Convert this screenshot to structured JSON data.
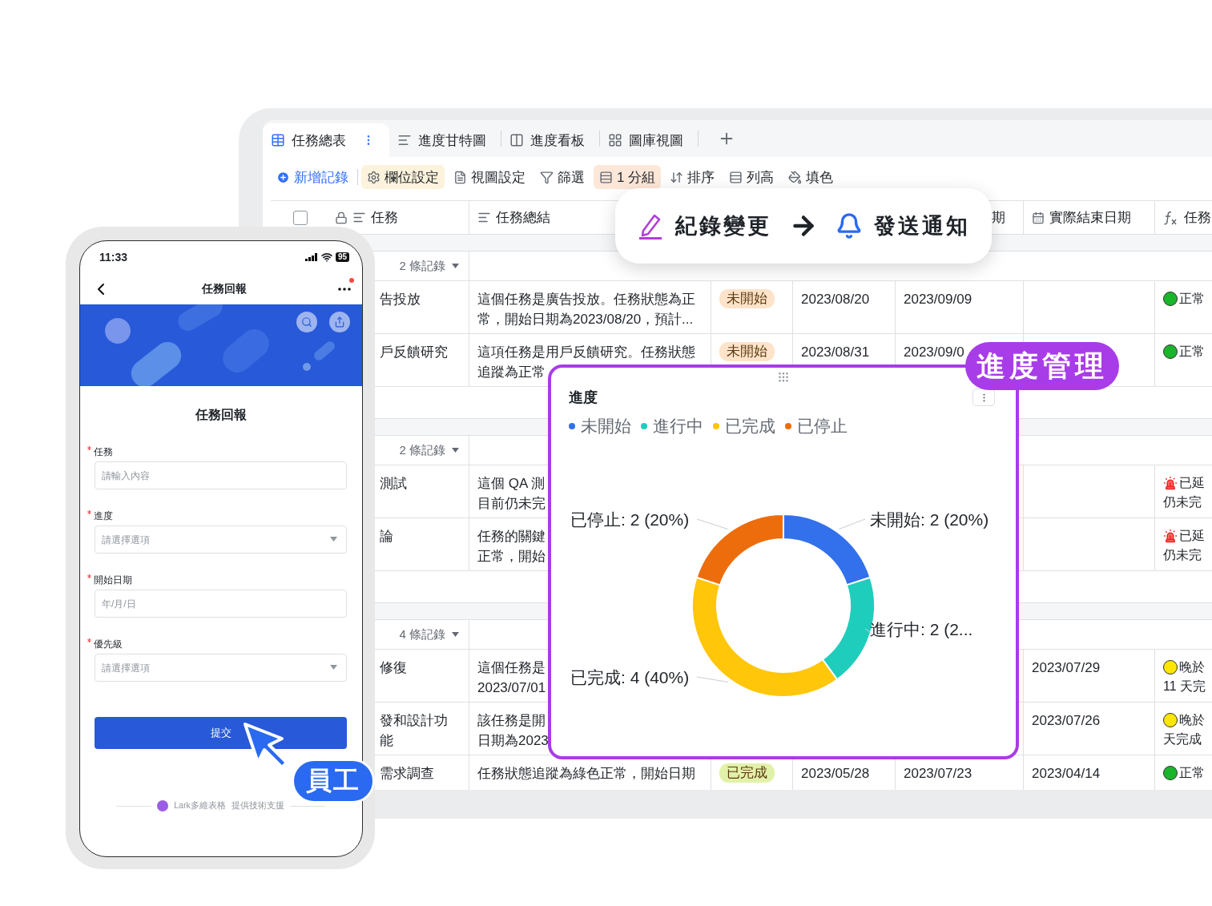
{
  "window": {
    "tabs": [
      {
        "label": "任務總表",
        "selected": true
      },
      {
        "label": "進度甘特圖",
        "selected": false
      },
      {
        "label": "進度看板",
        "selected": false
      },
      {
        "label": "圖庫視圖",
        "selected": false
      }
    ],
    "toolbar": [
      {
        "label": "新增記錄",
        "kind": "primary"
      },
      {
        "label": "欄位設定",
        "kind": "plain",
        "color": "#fdf3dc"
      },
      {
        "label": "視圖設定",
        "kind": "plain"
      },
      {
        "label": "篩選",
        "kind": "plain"
      },
      {
        "label": "1 分組",
        "kind": "plain",
        "color": "#fde7d8"
      },
      {
        "label": "排序",
        "kind": "plain"
      },
      {
        "label": "列高",
        "kind": "plain"
      },
      {
        "label": "填色",
        "kind": "plain"
      }
    ],
    "header": {
      "all_checked": false,
      "task": "任務",
      "summary": "任務總結",
      "column_5": "期",
      "actual_end": "實際結束日期",
      "column_7": "任務"
    },
    "groups": [
      {
        "count": "2 條記錄",
        "rows": [
          {
            "task": "告投放",
            "summary": "這個任務是廣告投放。任務狀態為正常，開始日期為2023/08/20，預計...",
            "tag": {
              "label": "未開始",
              "color": "#fde3c9"
            },
            "start": "2023/08/20",
            "end": "2023/09/09",
            "status": {
              "text": "正常",
              "kind": "ok"
            }
          },
          {
            "task": "戶反饋研究",
            "summary": "這項任務是用戶反饋研究。任務狀態追蹤為正常",
            "tag": {
              "label": "未開始",
              "color": "#fde3c9"
            },
            "start": "2023/08/31",
            "end": "2023/09/0",
            "status": {
              "text": "正常",
              "kind": "ok"
            }
          }
        ]
      },
      {
        "count": "2 條記錄",
        "rows": [
          {
            "task": "測試",
            "summary": "這個 QA 測目前仍未完",
            "status": {
              "text": "已延",
              "note": "仍未完",
              "kind": "late"
            }
          },
          {
            "task": "論",
            "summary": "任務的關鍵正常，開始",
            "status": {
              "text": "已延",
              "note": "仍未完",
              "kind": "late"
            }
          }
        ]
      },
      {
        "count": "4 條記錄",
        "rows": [
          {
            "task": "修復",
            "summary": "這個任務是2023/07/01",
            "actual_end": "2023/07/29",
            "status": {
              "text": "晚於",
              "note": "11 天完",
              "kind": "warn"
            }
          },
          {
            "task": "發和設計功能",
            "summary": "該任務是開日期為2023",
            "actual_end": "2023/07/26",
            "status": {
              "text": "晚於",
              "note": "天完成",
              "kind": "warn"
            }
          },
          {
            "task": "需求調查",
            "summary": "任務狀態追蹤為綠色正常，開始日期",
            "tag": {
              "label": "已完成",
              "color": "#e2f1a9"
            },
            "start": "2023/05/28",
            "end": "2023/07/23",
            "actual_end": "2023/04/14",
            "status": {
              "text": "正常",
              "kind": "ok"
            }
          }
        ]
      }
    ]
  },
  "callout": {
    "left": "紀錄變更",
    "right": "發送通知"
  },
  "chart": {
    "badge": "進度管理",
    "title": "進度",
    "chart_data": {
      "type": "donut",
      "categories": [
        "未開始",
        "進行中",
        "已完成",
        "已停止"
      ],
      "values": [
        2,
        2,
        4,
        2
      ],
      "colors": [
        "#3370eb",
        "#1fcdbd",
        "#ffc60a",
        "#ed6d0c"
      ],
      "value_labels": [
        "未開始: 2 (20%)",
        "進行中: 2 (2...",
        "已完成: 4 (40%)",
        "已停止: 2 (20%)"
      ]
    }
  },
  "phone": {
    "time": "11:33",
    "battery": "95",
    "title": "任務回報",
    "notification": true,
    "form_title": "任務回報",
    "fields": [
      {
        "label": "任務",
        "placeholder": "請輸入內容",
        "kind": "text",
        "required": true
      },
      {
        "label": "進度",
        "placeholder": "請選擇選項",
        "kind": "select",
        "required": true
      },
      {
        "label": "開始日期",
        "placeholder": "年/月/日",
        "kind": "text",
        "required": true
      },
      {
        "label": "優先級",
        "placeholder": "請選擇選項",
        "kind": "select",
        "required": true
      }
    ],
    "submit": "提交",
    "footer_brand": "Lark多維表格",
    "footer_note": "提供技術支援"
  },
  "employee_badge": "員工"
}
